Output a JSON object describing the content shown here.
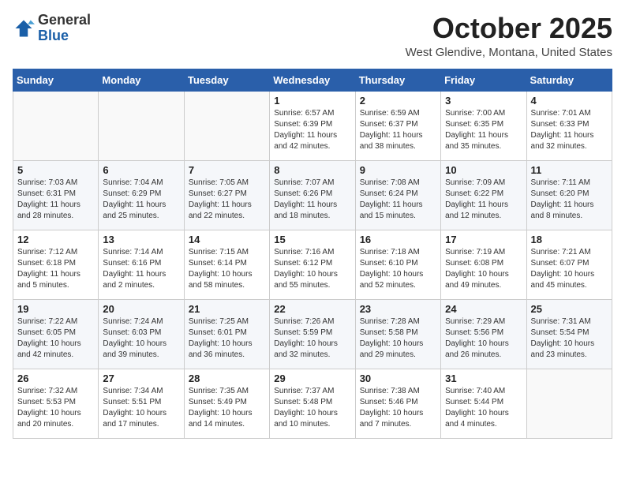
{
  "header": {
    "logo_general": "General",
    "logo_blue": "Blue",
    "month_title": "October 2025",
    "location": "West Glendive, Montana, United States"
  },
  "weekdays": [
    "Sunday",
    "Monday",
    "Tuesday",
    "Wednesday",
    "Thursday",
    "Friday",
    "Saturday"
  ],
  "weeks": [
    [
      {
        "day": "",
        "info": ""
      },
      {
        "day": "",
        "info": ""
      },
      {
        "day": "",
        "info": ""
      },
      {
        "day": "1",
        "info": "Sunrise: 6:57 AM\nSunset: 6:39 PM\nDaylight: 11 hours and 42 minutes."
      },
      {
        "day": "2",
        "info": "Sunrise: 6:59 AM\nSunset: 6:37 PM\nDaylight: 11 hours and 38 minutes."
      },
      {
        "day": "3",
        "info": "Sunrise: 7:00 AM\nSunset: 6:35 PM\nDaylight: 11 hours and 35 minutes."
      },
      {
        "day": "4",
        "info": "Sunrise: 7:01 AM\nSunset: 6:33 PM\nDaylight: 11 hours and 32 minutes."
      }
    ],
    [
      {
        "day": "5",
        "info": "Sunrise: 7:03 AM\nSunset: 6:31 PM\nDaylight: 11 hours and 28 minutes."
      },
      {
        "day": "6",
        "info": "Sunrise: 7:04 AM\nSunset: 6:29 PM\nDaylight: 11 hours and 25 minutes."
      },
      {
        "day": "7",
        "info": "Sunrise: 7:05 AM\nSunset: 6:27 PM\nDaylight: 11 hours and 22 minutes."
      },
      {
        "day": "8",
        "info": "Sunrise: 7:07 AM\nSunset: 6:26 PM\nDaylight: 11 hours and 18 minutes."
      },
      {
        "day": "9",
        "info": "Sunrise: 7:08 AM\nSunset: 6:24 PM\nDaylight: 11 hours and 15 minutes."
      },
      {
        "day": "10",
        "info": "Sunrise: 7:09 AM\nSunset: 6:22 PM\nDaylight: 11 hours and 12 minutes."
      },
      {
        "day": "11",
        "info": "Sunrise: 7:11 AM\nSunset: 6:20 PM\nDaylight: 11 hours and 8 minutes."
      }
    ],
    [
      {
        "day": "12",
        "info": "Sunrise: 7:12 AM\nSunset: 6:18 PM\nDaylight: 11 hours and 5 minutes."
      },
      {
        "day": "13",
        "info": "Sunrise: 7:14 AM\nSunset: 6:16 PM\nDaylight: 11 hours and 2 minutes."
      },
      {
        "day": "14",
        "info": "Sunrise: 7:15 AM\nSunset: 6:14 PM\nDaylight: 10 hours and 58 minutes."
      },
      {
        "day": "15",
        "info": "Sunrise: 7:16 AM\nSunset: 6:12 PM\nDaylight: 10 hours and 55 minutes."
      },
      {
        "day": "16",
        "info": "Sunrise: 7:18 AM\nSunset: 6:10 PM\nDaylight: 10 hours and 52 minutes."
      },
      {
        "day": "17",
        "info": "Sunrise: 7:19 AM\nSunset: 6:08 PM\nDaylight: 10 hours and 49 minutes."
      },
      {
        "day": "18",
        "info": "Sunrise: 7:21 AM\nSunset: 6:07 PM\nDaylight: 10 hours and 45 minutes."
      }
    ],
    [
      {
        "day": "19",
        "info": "Sunrise: 7:22 AM\nSunset: 6:05 PM\nDaylight: 10 hours and 42 minutes."
      },
      {
        "day": "20",
        "info": "Sunrise: 7:24 AM\nSunset: 6:03 PM\nDaylight: 10 hours and 39 minutes."
      },
      {
        "day": "21",
        "info": "Sunrise: 7:25 AM\nSunset: 6:01 PM\nDaylight: 10 hours and 36 minutes."
      },
      {
        "day": "22",
        "info": "Sunrise: 7:26 AM\nSunset: 5:59 PM\nDaylight: 10 hours and 32 minutes."
      },
      {
        "day": "23",
        "info": "Sunrise: 7:28 AM\nSunset: 5:58 PM\nDaylight: 10 hours and 29 minutes."
      },
      {
        "day": "24",
        "info": "Sunrise: 7:29 AM\nSunset: 5:56 PM\nDaylight: 10 hours and 26 minutes."
      },
      {
        "day": "25",
        "info": "Sunrise: 7:31 AM\nSunset: 5:54 PM\nDaylight: 10 hours and 23 minutes."
      }
    ],
    [
      {
        "day": "26",
        "info": "Sunrise: 7:32 AM\nSunset: 5:53 PM\nDaylight: 10 hours and 20 minutes."
      },
      {
        "day": "27",
        "info": "Sunrise: 7:34 AM\nSunset: 5:51 PM\nDaylight: 10 hours and 17 minutes."
      },
      {
        "day": "28",
        "info": "Sunrise: 7:35 AM\nSunset: 5:49 PM\nDaylight: 10 hours and 14 minutes."
      },
      {
        "day": "29",
        "info": "Sunrise: 7:37 AM\nSunset: 5:48 PM\nDaylight: 10 hours and 10 minutes."
      },
      {
        "day": "30",
        "info": "Sunrise: 7:38 AM\nSunset: 5:46 PM\nDaylight: 10 hours and 7 minutes."
      },
      {
        "day": "31",
        "info": "Sunrise: 7:40 AM\nSunset: 5:44 PM\nDaylight: 10 hours and 4 minutes."
      },
      {
        "day": "",
        "info": ""
      }
    ]
  ]
}
